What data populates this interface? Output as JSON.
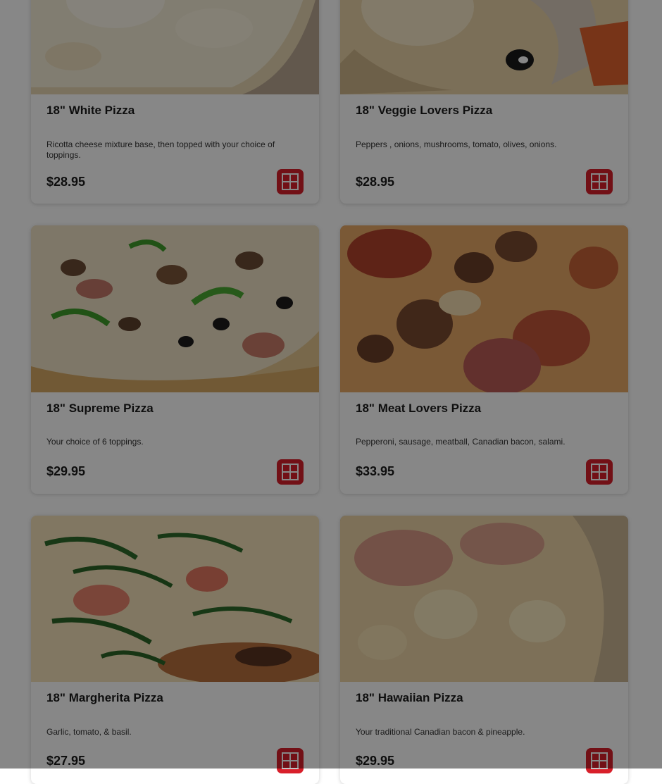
{
  "menu": {
    "items": [
      {
        "title": "18\" White Pizza",
        "description": "Ricotta cheese mixture base, then topped with your choice of toppings.",
        "price": "$28.95",
        "photo": "white-pizza-photo",
        "add_icon": "plus-icon"
      },
      {
        "title": "18\" Veggie Lovers Pizza",
        "description": "Peppers , onions, mushrooms, tomato, olives, onions.",
        "price": "$28.95",
        "photo": "veggie-pizza-photo",
        "add_icon": "plus-icon"
      },
      {
        "title": "18\" Supreme Pizza",
        "description": "Your choice of 6 toppings.",
        "price": "$29.95",
        "photo": "supreme-pizza-photo",
        "add_icon": "plus-icon"
      },
      {
        "title": "18\" Meat Lovers Pizza",
        "description": "Pepperoni, sausage, meatball, Canadian bacon, salami.",
        "price": "$33.95",
        "photo": "meat-lovers-pizza-photo",
        "add_icon": "plus-icon"
      },
      {
        "title": "18\" Margherita Pizza",
        "description": "Garlic, tomato, & basil.",
        "price": "$27.95",
        "photo": "margherita-pizza-photo",
        "add_icon": "plus-icon"
      },
      {
        "title": "18\" Hawaiian Pizza",
        "description": "Your traditional Canadian bacon & pineapple.",
        "price": "$29.95",
        "photo": "hawaiian-pizza-photo",
        "add_icon": "plus-icon"
      }
    ]
  },
  "colors": {
    "accent": "#d81f2a",
    "overlay": "rgba(0,0,0,0.47)"
  }
}
